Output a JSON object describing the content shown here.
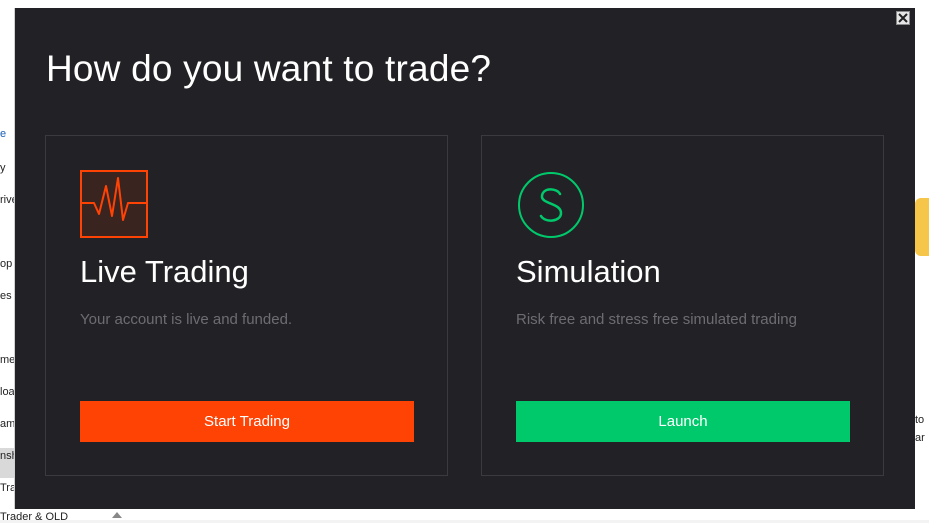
{
  "background": {
    "left_fragments": [
      "e",
      "y",
      "rive",
      "op",
      "es",
      "me",
      "loa",
      "am",
      "nsh",
      "Trac"
    ],
    "right_fragments": [
      "to",
      "ar"
    ],
    "bottom_fragment": "Trader & OLD"
  },
  "dialog": {
    "title": "How do you want to trade?",
    "close_icon": "close-x-icon"
  },
  "options": [
    {
      "title": "Live Trading",
      "description": "Your account is live and funded.",
      "button_label": "Start Trading",
      "icon": "heartbeat-monitor-icon",
      "accent_color": "#ff4305"
    },
    {
      "title": "Simulation",
      "description": "Risk free and stress free simulated trading",
      "button_label": "Launch",
      "icon": "s-circle-icon",
      "accent_color": "#00c96b"
    }
  ]
}
